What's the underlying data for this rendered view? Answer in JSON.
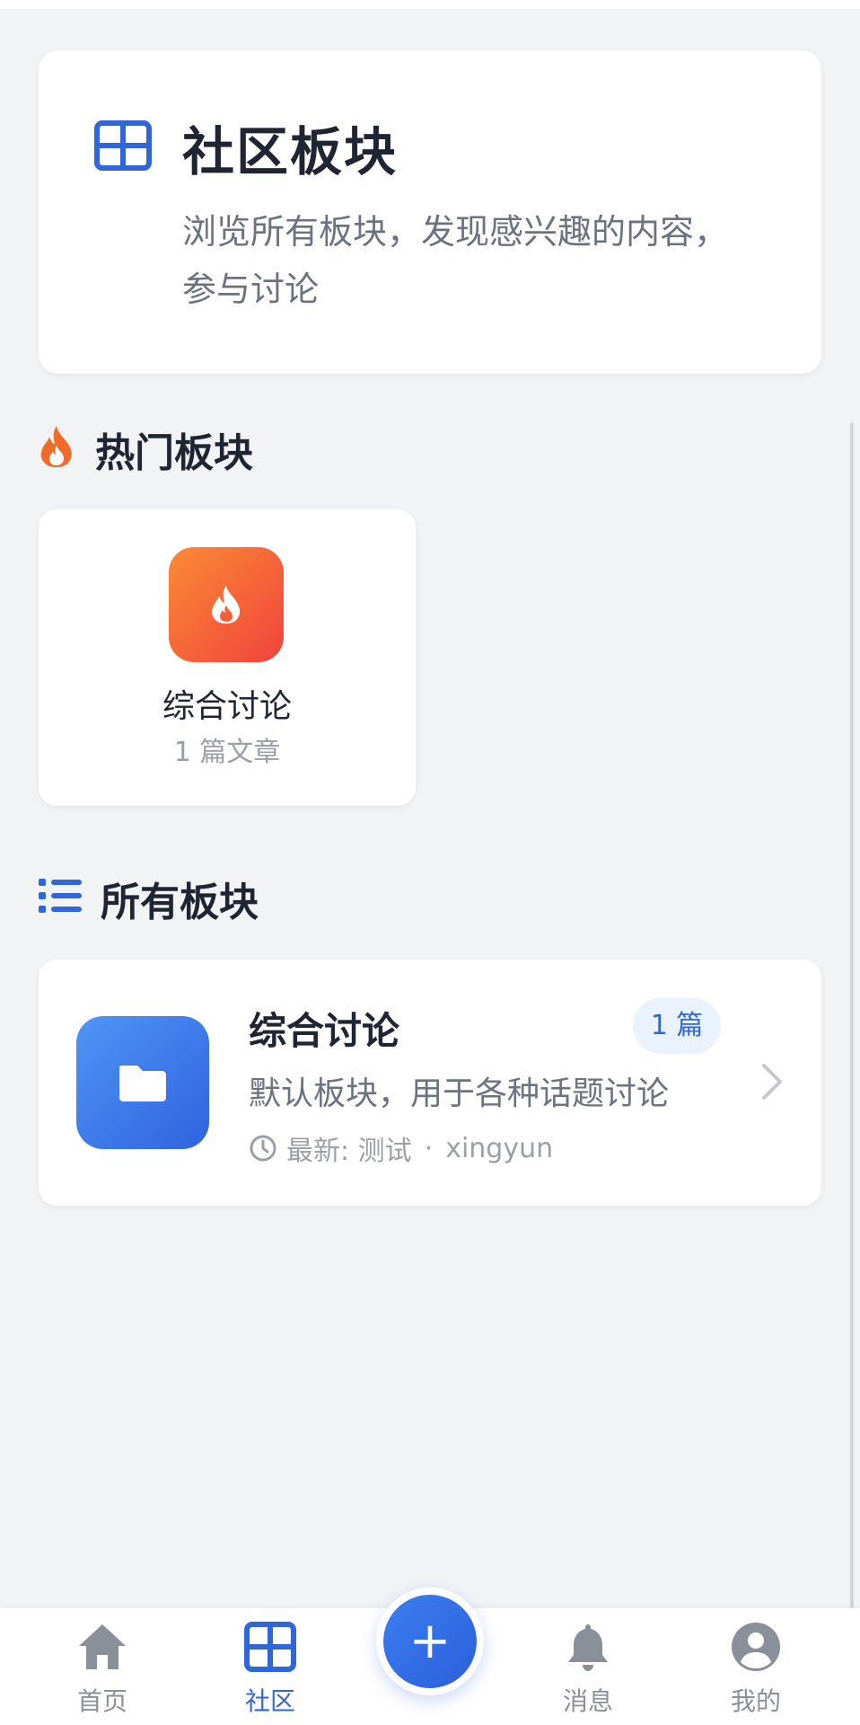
{
  "header": {
    "title": "社区板块",
    "description": "浏览所有板块，发现感兴趣的内容，参与讨论",
    "icon": "grid-icon"
  },
  "hot_section": {
    "title": "热门板块",
    "icon": "flame-icon",
    "items": [
      {
        "name": "综合讨论",
        "count": "1 篇文章",
        "icon": "flame-icon"
      }
    ]
  },
  "all_section": {
    "title": "所有板块",
    "icon": "list-icon",
    "items": [
      {
        "name": "综合讨论",
        "badge": "1 篇",
        "description": "默认板块，用于各种话题讨论",
        "latest_label": "最新: 测试",
        "latest_author": "xingyun",
        "separator": "·",
        "icon": "folder-icon"
      }
    ]
  },
  "bottom_nav": {
    "items": [
      {
        "label": "首页",
        "icon": "home-icon",
        "active": false
      },
      {
        "label": "社区",
        "icon": "grid-icon",
        "active": true
      },
      {
        "label": "消息",
        "icon": "bell-icon",
        "active": false
      },
      {
        "label": "我的",
        "icon": "user-icon",
        "active": false
      }
    ],
    "fab_label": "+"
  },
  "colors": {
    "primary": "#2f66d8",
    "flame": "#f26b2a",
    "background": "#f2f3f5",
    "text": "#1f2533",
    "muted": "#9aa0a8"
  }
}
